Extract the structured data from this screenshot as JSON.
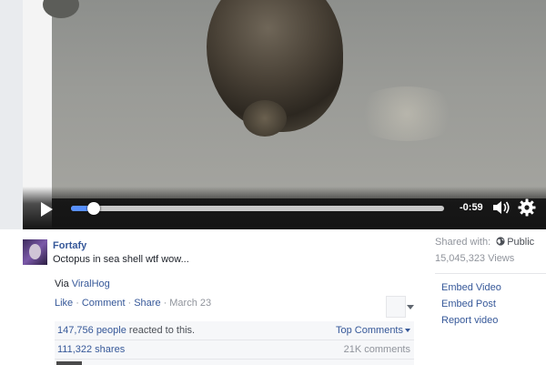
{
  "player": {
    "time_remaining": "-0:59",
    "progress_fraction": 0.04,
    "icons": {
      "play": "play-icon",
      "volume": "volume-icon",
      "settings": "gear-icon"
    }
  },
  "post": {
    "author": "Fortafy",
    "status": "Octopus in sea shell wtf wow...",
    "via_prefix": "Via ",
    "via_link": "ViralHog",
    "actions": {
      "like": "Like",
      "comment": "Comment",
      "share": "Share",
      "date": "March 23",
      "separator": "·"
    },
    "reactions": {
      "count": "147,756 people",
      "suffix": " reacted to this.",
      "sort": "Top Comments"
    },
    "shares": "111,322 shares",
    "comments": "21K comments"
  },
  "sidebar": {
    "shared_with_label": "Shared with:",
    "audience": "Public",
    "views": "15,045,323 Views",
    "links": [
      "Embed Video",
      "Embed Post",
      "Report video"
    ]
  },
  "colors": {
    "link": "#365899",
    "progress": "#5890ff",
    "muted": "#90949c"
  }
}
